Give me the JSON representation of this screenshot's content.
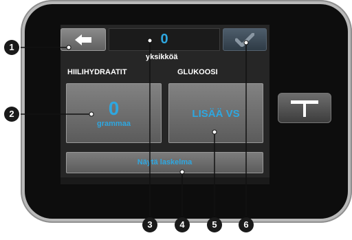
{
  "header": {
    "units_value": "0",
    "units_label": "yksikköä"
  },
  "sections": {
    "carbs_label": "HIILIHYDRAATIT",
    "glucose_label": "GLUKOOSI"
  },
  "carbs_tile": {
    "value": "0",
    "unit": "grammaa"
  },
  "glucose_tile": {
    "text": "LISÄÄ VS"
  },
  "calc_button": {
    "label": "Näytä laskelma"
  },
  "callouts": [
    "1",
    "2",
    "3",
    "4",
    "5",
    "6"
  ],
  "colors": {
    "accent": "#2ea7e0",
    "screen": "#262626",
    "bezel": "#0d0d0d",
    "frame": "#b9b9b9",
    "callout": "#1a1a1a"
  },
  "icons": {
    "back": "left-arrow-icon",
    "confirm": "checkmark-icon",
    "hardware": "t-logo-icon"
  }
}
